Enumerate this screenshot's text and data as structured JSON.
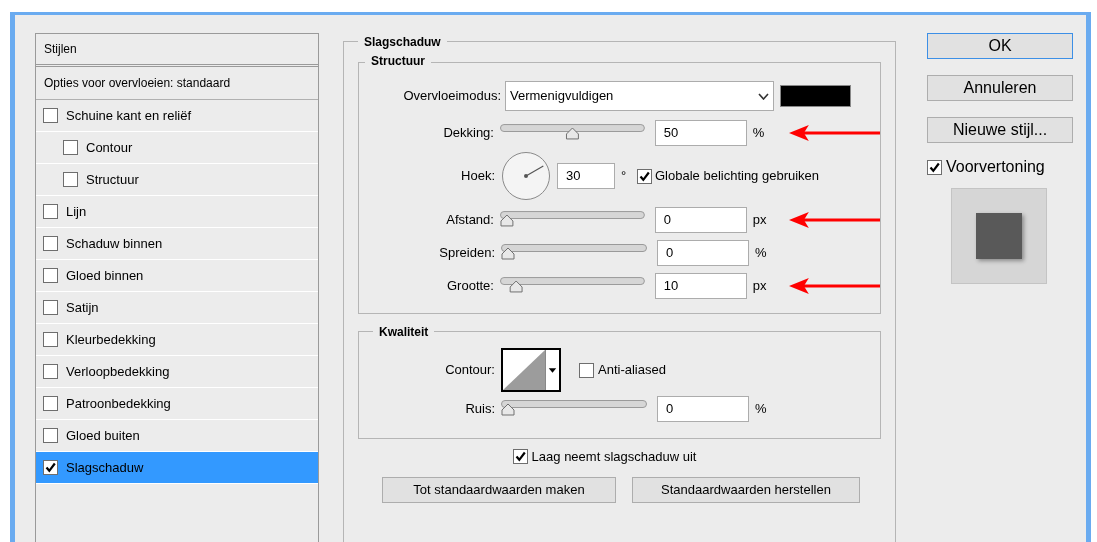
{
  "styles_panel": {
    "title": "Stijlen",
    "blend_options": "Opties voor overvloeien: standaard",
    "items": [
      {
        "label": "Schuine kant en reliëf",
        "checked": false,
        "selected": false,
        "children": [
          {
            "label": "Contour",
            "checked": false,
            "selected": false
          },
          {
            "label": "Structuur",
            "checked": false,
            "selected": false
          }
        ]
      },
      {
        "label": "Lijn",
        "checked": false,
        "selected": false
      },
      {
        "label": "Schaduw binnen",
        "checked": false,
        "selected": false
      },
      {
        "label": "Gloed binnen",
        "checked": false,
        "selected": false
      },
      {
        "label": "Satijn",
        "checked": false,
        "selected": false
      },
      {
        "label": "Kleurbedekking",
        "checked": false,
        "selected": false
      },
      {
        "label": "Verloopbedekking",
        "checked": false,
        "selected": false
      },
      {
        "label": "Patroonbedekking",
        "checked": false,
        "selected": false
      },
      {
        "label": "Gloed buiten",
        "checked": false,
        "selected": false
      },
      {
        "label": "Slagschaduw",
        "checked": true,
        "selected": true
      }
    ]
  },
  "section": {
    "title": "Slagschaduw",
    "structure": {
      "title": "Structuur",
      "blend_mode": {
        "label": "Overvloeimodus:",
        "value": "Vermenigvuldigen",
        "color": "#000000"
      },
      "rows": [
        {
          "kind": "slider",
          "label": "Dekking:",
          "value": "50",
          "unit": "%",
          "level": 0.5,
          "annotated": true
        },
        {
          "kind": "angle",
          "label": "Hoek:",
          "value": "30",
          "unit": "°",
          "checkbox": {
            "label": "Globale belichting gebruiken",
            "checked": true
          }
        },
        {
          "kind": "slider",
          "label": "Afstand:",
          "value": "0",
          "unit": "px",
          "level": 0,
          "annotated": true
        },
        {
          "kind": "slider",
          "label": "Spreiden:",
          "value": "0",
          "unit": "%",
          "level": 0,
          "annotated": false
        },
        {
          "kind": "slider",
          "label": "Grootte:",
          "value": "10",
          "unit": "px",
          "level": 0.07,
          "annotated": true
        }
      ]
    },
    "quality": {
      "title": "Kwaliteit",
      "contour_label": "Contour:",
      "anti_aliased": {
        "label": "Anti-aliased",
        "checked": false
      },
      "noise": {
        "label": "Ruis:",
        "value": "0",
        "unit": "%",
        "level": 0
      }
    },
    "knockout": {
      "label": "Laag neemt slagschaduw uit",
      "checked": true
    },
    "buttons": [
      "Tot standaardwaarden maken",
      "Standaardwaarden herstellen"
    ]
  },
  "actions": {
    "buttons": [
      {
        "label": "OK",
        "default": true
      },
      {
        "label": "Annuleren",
        "default": false
      },
      {
        "label": "Nieuwe stijl...",
        "default": false
      }
    ],
    "preview": {
      "label": "Voorvertoning",
      "checked": true
    }
  }
}
